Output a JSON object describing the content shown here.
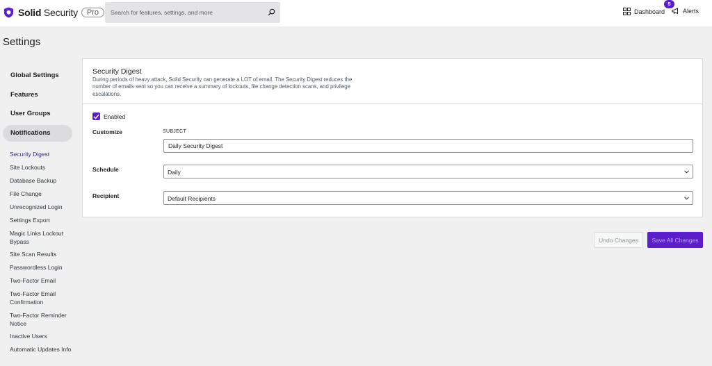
{
  "header": {
    "brand_bold": "Solid",
    "brand_rest": " Security",
    "pro_label": "Pro",
    "search_placeholder": "Search for features, settings, and more",
    "dashboard_label": "Dashboard",
    "alerts_label": "Alerts",
    "alerts_count": "5"
  },
  "page": {
    "title": "Settings"
  },
  "sidebar": {
    "main_items": [
      {
        "label": "Global Settings",
        "active": false
      },
      {
        "label": "Features",
        "active": false
      },
      {
        "label": "User Groups",
        "active": false
      },
      {
        "label": "Notifications",
        "active": true
      }
    ],
    "sub_items": [
      {
        "label": "Security Digest",
        "active": true
      },
      {
        "label": "Site Lockouts"
      },
      {
        "label": "Database Backup"
      },
      {
        "label": "File Change"
      },
      {
        "label": "Unrecognized Login"
      },
      {
        "label": "Settings Export"
      },
      {
        "label": "Magic Links Lockout Bypass"
      },
      {
        "label": "Site Scan Results"
      },
      {
        "label": "Passwordless Login"
      },
      {
        "label": "Two-Factor Email"
      },
      {
        "label": "Two-Factor Email Confirmation"
      },
      {
        "label": "Two-Factor Reminder Notice"
      },
      {
        "label": "Inactive Users"
      },
      {
        "label": "Automatic Updates Info"
      }
    ]
  },
  "panel": {
    "title": "Security Digest",
    "description": "During periods of heavy attack, Solid Security can generate a LOT of email. The Security Digest reduces the number of emails sent so you can receive a summary of lockouts, file change detection scans, and privilege escalations.",
    "enabled_label": "Enabled",
    "enabled": true,
    "customize_label": "Customize",
    "subject_caption": "SUBJECT",
    "subject_value": "Daily Security Digest",
    "schedule_label": "Schedule",
    "schedule_value": "Daily",
    "recipient_label": "Recipient",
    "recipient_value": "Default Recipients"
  },
  "actions": {
    "undo_label": "Undo Changes",
    "save_label": "Save All Changes"
  },
  "colors": {
    "accent": "#5b1ec9",
    "background": "#f0f0f1"
  }
}
